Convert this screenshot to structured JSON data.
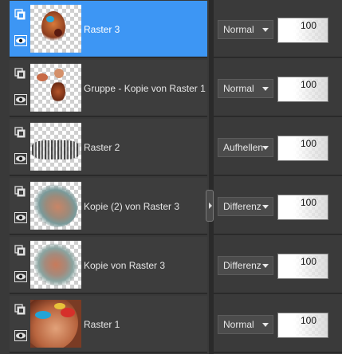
{
  "layers": [
    {
      "name": "Raster 3",
      "blend_mode": "Normal",
      "opacity": "100",
      "selected": true
    },
    {
      "name": "Gruppe - Kopie von Raster 1",
      "blend_mode": "Normal",
      "opacity": "100",
      "selected": false
    },
    {
      "name": "Raster 2",
      "blend_mode": "Aufhellen",
      "opacity": "100",
      "selected": false
    },
    {
      "name": "Kopie (2) von Raster 3",
      "blend_mode": "Differenz",
      "opacity": "100",
      "selected": false
    },
    {
      "name": "Kopie von Raster 3",
      "blend_mode": "Differenz",
      "opacity": "100",
      "selected": false
    },
    {
      "name": "Raster 1",
      "blend_mode": "Normal",
      "opacity": "100",
      "selected": false
    }
  ],
  "icons": {
    "layer": "layer-type-icon",
    "visibility": "eye-icon",
    "dropdown": "chevron-down-icon",
    "splitter": "chevron-right-icon"
  },
  "colors": {
    "selected_row": "#3d96f4",
    "row_bg": "#3d3d3d",
    "panel_bg": "#3a3a3a"
  }
}
